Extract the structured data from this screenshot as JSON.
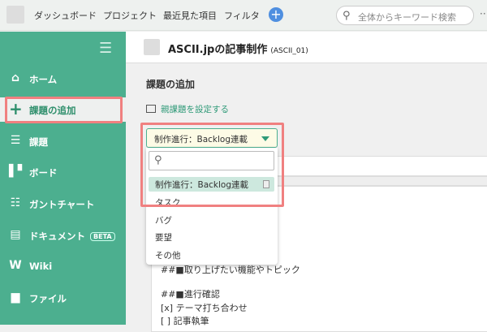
{
  "topbar": {
    "nav": [
      "ダッシュボード",
      "プロジェクト",
      "最近見た項目",
      "フィルタ"
    ],
    "add": "+",
    "search_placeholder": "全体からキーワード検索",
    "more": "··"
  },
  "sidebar": {
    "items": [
      {
        "icon": "home-icon",
        "glyph": "⌂",
        "label": "ホーム"
      },
      {
        "icon": "plus-icon",
        "glyph": "+",
        "label": "課題の追加"
      },
      {
        "icon": "list-icon",
        "glyph": "☰",
        "label": "課題"
      },
      {
        "icon": "board-icon",
        "glyph": "▌▘",
        "label": "ボード"
      },
      {
        "icon": "gantt-icon",
        "glyph": "☷",
        "label": "ガントチャート"
      },
      {
        "icon": "document-icon",
        "glyph": "▤",
        "label": "ドキュメント",
        "badge": "BETA"
      },
      {
        "icon": "wiki-icon",
        "glyph": "W",
        "label": "Wiki"
      },
      {
        "icon": "folder-icon",
        "glyph": "▆",
        "label": "ファイル"
      }
    ]
  },
  "project": {
    "title": "ASCII.jpの記事制作",
    "key": "(ASCII_01)"
  },
  "page": {
    "heading": "課題の追加",
    "parent_link": "親課題を設定する"
  },
  "issue_type": {
    "selected": "制作進行：Backlog連載",
    "options": [
      "制作進行：Backlog連載",
      "タスク",
      "バグ",
      "要望",
      "その他"
    ]
  },
  "description": [
    "##■取り上げたい機能やトピック",
    "##■進行確認",
    "[x] テーマ打ち合わせ",
    "[ ] 記事執筆"
  ]
}
